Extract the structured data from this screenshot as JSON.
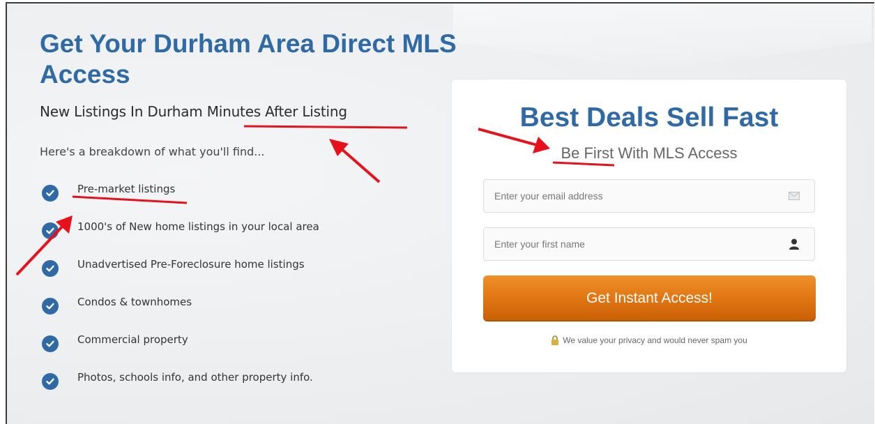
{
  "left": {
    "headline": "Get Your Durham Area Direct MLS Access",
    "subhead": "New Listings In Durham Minutes After Listing",
    "breakdown_intro": "Here's a breakdown of what you'll find...",
    "features": [
      "Pre-market listings",
      "1000's of New home listings in your local area",
      "Unadvertised Pre-Foreclosure home listings",
      "Condos & townhomes",
      "Commercial property",
      "Photos, schools info, and other property info."
    ]
  },
  "form": {
    "title": "Best Deals Sell Fast",
    "subtitle": "Be First With MLS Access",
    "email_placeholder": "Enter your email address",
    "email_icon": "envelope-icon",
    "name_placeholder": "Enter your first name",
    "name_icon": "user-icon",
    "submit_label": "Get Instant Access!",
    "privacy_icon": "lock-icon",
    "privacy_text": "We value your privacy and would never spam you"
  },
  "colors": {
    "brand_blue": "#2f6aa6",
    "cta_orange": "#e07613",
    "annotation_red": "#e8101a"
  }
}
